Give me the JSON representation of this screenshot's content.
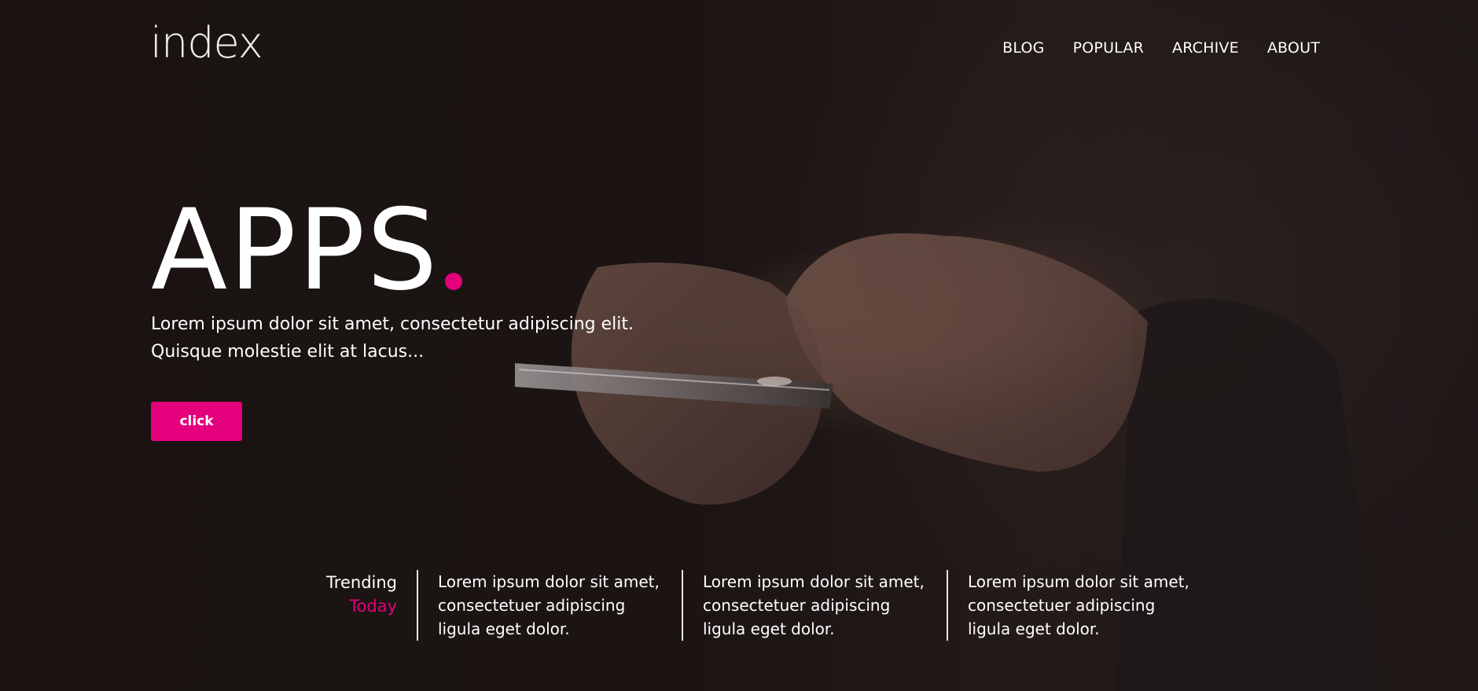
{
  "brand": {
    "logo_text": "index",
    "accent_color": "#e4007c"
  },
  "nav": {
    "items": [
      {
        "label": "BLOG"
      },
      {
        "label": "POPULAR"
      },
      {
        "label": "ARCHIVE"
      },
      {
        "label": "ABOUT"
      }
    ]
  },
  "hero": {
    "title": "APPS",
    "subtitle_line1": "Lorem ipsum dolor sit amet, consectetur adipiscing elit.",
    "subtitle_line2": "Quisque molestie elit at lacus...",
    "button_label": "click",
    "background_icon": "hands-holding-phone"
  },
  "trending": {
    "label_line1": "Trending",
    "label_line2": "Today",
    "items": [
      {
        "line1": "Lorem ipsum dolor sit amet,",
        "line2": "consectetuer adipiscing",
        "line3": "ligula eget dolor."
      },
      {
        "line1": "Lorem ipsum dolor sit amet,",
        "line2": "consectetuer adipiscing",
        "line3": "ligula eget dolor."
      },
      {
        "line1": "Lorem ipsum dolor sit amet,",
        "line2": "consectetuer adipiscing",
        "line3": "ligula eget dolor."
      }
    ]
  }
}
